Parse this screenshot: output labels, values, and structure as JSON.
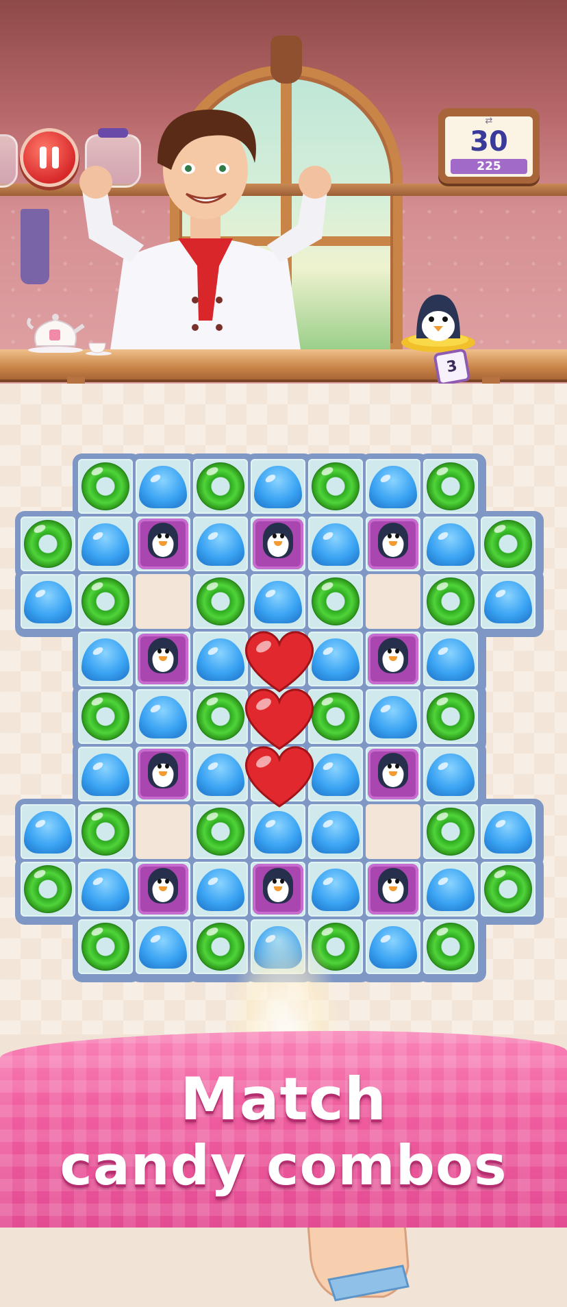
{
  "hud": {
    "moves_left": "30",
    "score": "225",
    "goal_count": "3",
    "goal_icon": "penguin-icon",
    "pause_icon": "pause-icon"
  },
  "board": {
    "rows": [
      [
        "gap",
        "donut",
        "drop",
        "donut",
        "drop",
        "donut",
        "drop",
        "donut",
        "gap"
      ],
      [
        "donut",
        "drop",
        "penguin",
        "drop",
        "penguin",
        "drop",
        "penguin",
        "drop",
        "donut"
      ],
      [
        "drop",
        "donut",
        "empty",
        "donut",
        "drop",
        "donut",
        "empty",
        "donut",
        "drop"
      ],
      [
        "gap",
        "drop",
        "penguin",
        "drop",
        "heart",
        "drop",
        "penguin",
        "drop",
        "gap"
      ],
      [
        "gap",
        "donut",
        "drop",
        "donut",
        "heart",
        "donut",
        "drop",
        "donut",
        "gap"
      ],
      [
        "gap",
        "drop",
        "penguin",
        "drop",
        "heart",
        "drop",
        "penguin",
        "drop",
        "gap"
      ],
      [
        "drop",
        "donut",
        "empty",
        "donut",
        "drop",
        "drop",
        "empty",
        "donut",
        "drop"
      ],
      [
        "donut",
        "drop",
        "penguin",
        "drop",
        "penguin",
        "drop",
        "penguin",
        "drop",
        "donut"
      ],
      [
        "gap",
        "donut",
        "drop",
        "donut",
        "drop",
        "donut",
        "drop",
        "donut",
        "gap"
      ]
    ]
  },
  "colors": {
    "donut": "#3cc42a",
    "drop": "#3aa3f3",
    "heart": "#e0282e",
    "penguin_box": "#a946b0",
    "banner": "#f05d9f"
  },
  "banner": {
    "line1": "Match",
    "line2": "candy combos"
  }
}
